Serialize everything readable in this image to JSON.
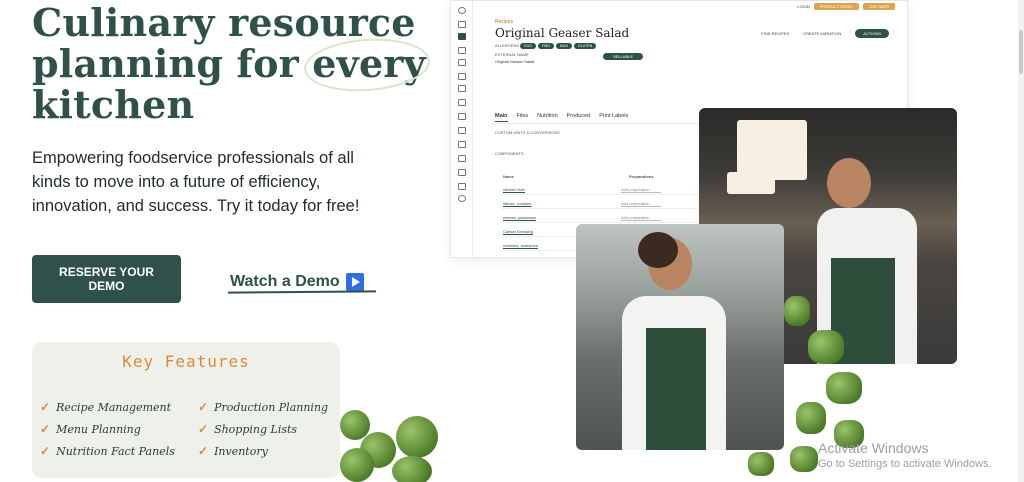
{
  "hero": {
    "title_line1": "Culinary resource",
    "title_line2_pre": "planning for ",
    "title_line2_highlight": "every",
    "title_line3": "kitchen",
    "subtitle": "Empowering foodservice professionals of all kinds to move into a future of efficiency, innovation, and success. Try it today for free!"
  },
  "cta": {
    "reserve_label": "RESERVE YOUR DEMO",
    "watch_label": "Watch a Demo"
  },
  "features": {
    "title": "Key Features",
    "items": [
      "Recipe Management",
      "Production Planning",
      "Menu Planning",
      "Shopping Lists",
      "Nutrition Fact Panels",
      "Inventory"
    ]
  },
  "app": {
    "top_login": "LOGIN",
    "top_btn1": "PRODUCT DEMO",
    "top_btn2": "JOB FAIRS",
    "crumb": "Recipes",
    "title": "Original Geaser Salad",
    "btn_find": "FIND RECIPES",
    "btn_create": "CREATE VARIATION",
    "btn_actions": "ACTIONS",
    "allergens_label": "ALLERGENS",
    "allergen_chips": [
      "EGG",
      "FISH",
      "MILK",
      "GLUTEN"
    ],
    "external_name_label": "EXTERNAL NAME",
    "external_name_value": "Original Geaser Salad",
    "sellable": "SELLABLE",
    "tabs": [
      "Main",
      "Files",
      "Nutrition",
      "Produced",
      "Print Labels"
    ],
    "custom_units": "CUSTOM UNITS & CONVERSIONS",
    "components": "COMPONENTS",
    "col_name": "Name",
    "col_prep": "Preparations",
    "rows": [
      "chicken liver",
      "lettuce, romaine",
      "cheese, parmesan",
      "Caesar Dressing",
      "croutons, seasoned"
    ],
    "prep_placeholder": "Add preparation"
  },
  "os": {
    "activate_title": "Activate Windows",
    "activate_sub": "Go to Settings to activate Windows."
  },
  "colors": {
    "brand_green": "#2f5149",
    "accent_orange": "#d98a3d",
    "feature_bg": "#eef1ea"
  }
}
